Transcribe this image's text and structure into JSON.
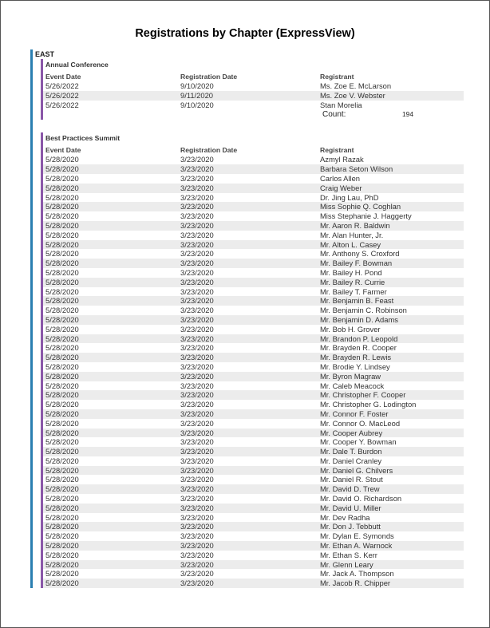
{
  "report": {
    "title": "Registrations by Chapter (ExpressView)"
  },
  "region": {
    "name": "EAST"
  },
  "columns": {
    "event_date": "Event Date",
    "registration_date": "Registration Date",
    "registrant": "Registrant"
  },
  "groups": [
    {
      "title": "Annual Conference",
      "count_label": "Count:",
      "count_value": "194",
      "rows": [
        [
          "5/26/2022",
          "9/10/2020",
          "Ms. Zoe E. McLarson"
        ],
        [
          "5/26/2022",
          "9/11/2020",
          "Ms. Zoe V. Webster"
        ],
        [
          "5/26/2022",
          "9/10/2020",
          "Stan Morelia"
        ]
      ]
    },
    {
      "title": "Best Practices Summit",
      "rows": [
        [
          "5/28/2020",
          "3/23/2020",
          "Azmyl Razak"
        ],
        [
          "5/28/2020",
          "3/23/2020",
          "Barbara Seton Wilson"
        ],
        [
          "5/28/2020",
          "3/23/2020",
          "Carlos Allen"
        ],
        [
          "5/28/2020",
          "3/23/2020",
          "Craig Weber"
        ],
        [
          "5/28/2020",
          "3/23/2020",
          "Dr. Jing Lau, PhD"
        ],
        [
          "5/28/2020",
          "3/23/2020",
          "Miss Sophie Q. Coghlan"
        ],
        [
          "5/28/2020",
          "3/23/2020",
          "Miss Stephanie J. Haggerty"
        ],
        [
          "5/28/2020",
          "3/23/2020",
          "Mr. Aaron R. Baldwin"
        ],
        [
          "5/28/2020",
          "3/23/2020",
          "Mr. Alan Hunter, Jr."
        ],
        [
          "5/28/2020",
          "3/23/2020",
          "Mr. Alton L. Casey"
        ],
        [
          "5/28/2020",
          "3/23/2020",
          "Mr. Anthony S. Croxford"
        ],
        [
          "5/28/2020",
          "3/23/2020",
          "Mr. Bailey F. Bowman"
        ],
        [
          "5/28/2020",
          "3/23/2020",
          "Mr. Bailey H. Pond"
        ],
        [
          "5/28/2020",
          "3/23/2020",
          "Mr. Bailey R. Currie"
        ],
        [
          "5/28/2020",
          "3/23/2020",
          "Mr. Bailey T. Farmer"
        ],
        [
          "5/28/2020",
          "3/23/2020",
          "Mr. Benjamin B. Feast"
        ],
        [
          "5/28/2020",
          "3/23/2020",
          "Mr. Benjamin C. Robinson"
        ],
        [
          "5/28/2020",
          "3/23/2020",
          "Mr. Benjamin D. Adams"
        ],
        [
          "5/28/2020",
          "3/23/2020",
          "Mr. Bob H. Grover"
        ],
        [
          "5/28/2020",
          "3/23/2020",
          "Mr. Brandon P. Leopold"
        ],
        [
          "5/28/2020",
          "3/23/2020",
          "Mr. Brayden R. Cooper"
        ],
        [
          "5/28/2020",
          "3/23/2020",
          "Mr. Brayden R. Lewis"
        ],
        [
          "5/28/2020",
          "3/23/2020",
          "Mr. Brodie Y. Lindsey"
        ],
        [
          "5/28/2020",
          "3/23/2020",
          "Mr. Byron Magraw"
        ],
        [
          "5/28/2020",
          "3/23/2020",
          "Mr. Caleb Meacock"
        ],
        [
          "5/28/2020",
          "3/23/2020",
          "Mr. Christopher F. Cooper"
        ],
        [
          "5/28/2020",
          "3/23/2020",
          "Mr. Christopher G. Lodington"
        ],
        [
          "5/28/2020",
          "3/23/2020",
          "Mr. Connor F. Foster"
        ],
        [
          "5/28/2020",
          "3/23/2020",
          "Mr. Connor O. MacLeod"
        ],
        [
          "5/28/2020",
          "3/23/2020",
          "Mr. Cooper Aubrey"
        ],
        [
          "5/28/2020",
          "3/23/2020",
          "Mr. Cooper Y. Bowman"
        ],
        [
          "5/28/2020",
          "3/23/2020",
          "Mr. Dale T. Burdon"
        ],
        [
          "5/28/2020",
          "3/23/2020",
          "Mr. Daniel Cranley"
        ],
        [
          "5/28/2020",
          "3/23/2020",
          "Mr. Daniel G. Chilvers"
        ],
        [
          "5/28/2020",
          "3/23/2020",
          "Mr. Daniel R. Stout"
        ],
        [
          "5/28/2020",
          "3/23/2020",
          "Mr. David D. Trew"
        ],
        [
          "5/28/2020",
          "3/23/2020",
          "Mr. David O. Richardson"
        ],
        [
          "5/28/2020",
          "3/23/2020",
          "Mr. David U. Miller"
        ],
        [
          "5/28/2020",
          "3/23/2020",
          "Mr. Dev Radha"
        ],
        [
          "5/28/2020",
          "3/23/2020",
          "Mr. Don J. Tebbutt"
        ],
        [
          "5/28/2020",
          "3/23/2020",
          "Mr. Dylan E. Symonds"
        ],
        [
          "5/28/2020",
          "3/23/2020",
          "Mr. Ethan A. Warnock"
        ],
        [
          "5/28/2020",
          "3/23/2020",
          "Mr. Ethan S. Kerr"
        ],
        [
          "5/28/2020",
          "3/23/2020",
          "Mr. Glenn Leary"
        ],
        [
          "5/28/2020",
          "3/23/2020",
          "Mr. Jack A. Thompson"
        ],
        [
          "5/28/2020",
          "3/23/2020",
          "Mr. Jacob R. Chipper"
        ]
      ]
    }
  ],
  "colors": {
    "region_bar": "#2a7fb1",
    "group_bar": "#8a57a8",
    "alt_row": "#ececec"
  }
}
